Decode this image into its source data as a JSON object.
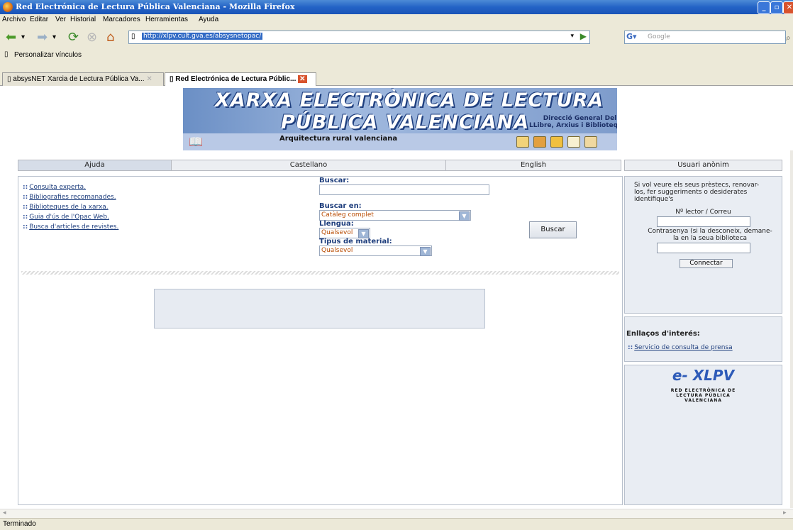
{
  "window": {
    "title": "Red Electrónica de Lectura Pública Valenciana - Mozilla Firefox"
  },
  "menu": {
    "items": [
      "Archivo",
      "Editar",
      "Ver",
      "Historial",
      "Marcadores",
      "Herramientas",
      "Ayuda"
    ]
  },
  "nav": {
    "url": "http://xlpv.cult.gva.es/absysnetopac/",
    "search_placeholder": "Google"
  },
  "bookmarks": {
    "label": "Personalizar vínculos"
  },
  "tabs": [
    {
      "label": "absysNET Xarcia de Lectura Pública Va..."
    },
    {
      "label": "Red Electrónica de Lectura Públic..."
    }
  ],
  "banner": {
    "line1": "XARXA ELECTRÒNICA DE LECTURA",
    "line2": "PÚBLICA VALENCIANA",
    "dg_line1": "Direcció General Del",
    "dg_line2": "LLibre, Arxius i Biblioteques",
    "caption": "Arquitectura rural valenciana"
  },
  "page_tabs": {
    "ajuda": "Ajuda",
    "castellano": "Castellano",
    "english": "English",
    "user": "Usuari anònim"
  },
  "links": [
    "Consulta experta.",
    "Bibliografies recomanades.",
    "Biblioteques de la xarxa.",
    "Guia d'ús de l'Opac Web.",
    "Busca d'articles de revistes."
  ],
  "bullet": "::",
  "search": {
    "buscar_label": "Buscar:",
    "buscar_en_label": "Buscar en:",
    "buscar_en_value": "Catàleg complet",
    "llengua_label": "Llengua:",
    "llengua_value": "Qualsevol",
    "tipus_label": "Tipus de material:",
    "tipus_value": "Qualsevol",
    "button": "Buscar"
  },
  "login": {
    "intro": "Si vol veure els seus prèstecs, renovar-los, fer suggeriments o desiderates identifique's",
    "lector_label": "Nº lector / Correu",
    "password_label": "Contrasenya (si la desconeix, demane-la en la seua biblioteca",
    "connect": "Connectar"
  },
  "interest": {
    "title": "Enllaços d'interés:",
    "link": "Servicio de consulta de prensa"
  },
  "logo": {
    "name": "e- XLPV",
    "line1": "RED ELECTRÒNICA DE",
    "line2": "LECTURA PÚBLICA",
    "line3": "VALENCIANA"
  },
  "status": {
    "text": "Terminado"
  },
  "colors": {
    "titlebar": "#2363c6",
    "link": "#1d3d7c",
    "select_text": "#b84a00",
    "logo": "#2e5bb8"
  }
}
